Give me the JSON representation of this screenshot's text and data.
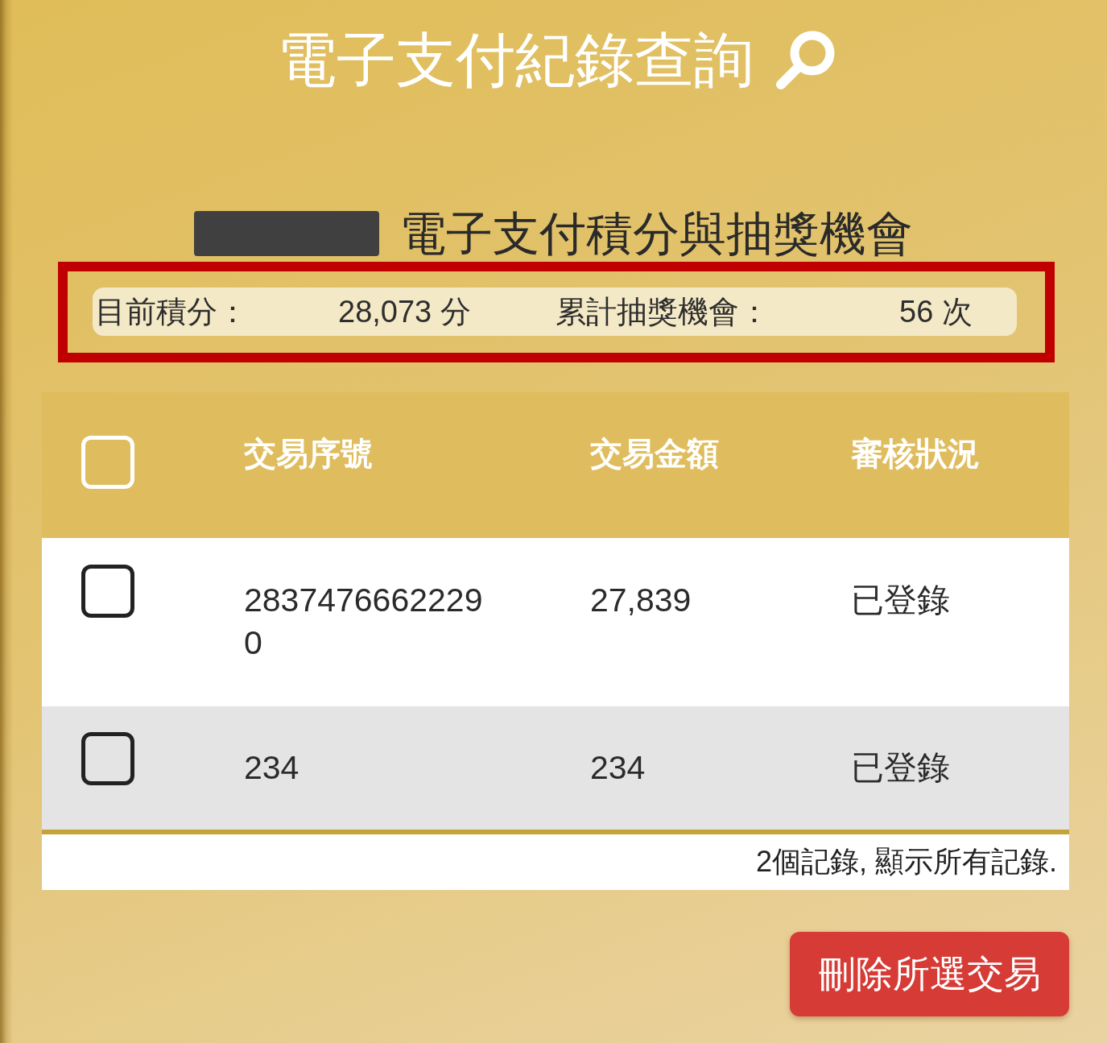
{
  "header": {
    "title": "電子支付紀錄查詢"
  },
  "summary": {
    "subtitle": "電子支付積分與抽獎機會",
    "highlighted": true,
    "stats": [
      {
        "label": "目前積分：",
        "value": "28,073 分"
      },
      {
        "label": "累計抽獎機會：",
        "value": "56 次"
      }
    ]
  },
  "table": {
    "select_all": {
      "checked": false
    },
    "columns": [
      "交易序號",
      "交易金額",
      "審核狀況"
    ],
    "rows": [
      {
        "checked": false,
        "cells": [
          "28374766622290",
          "27,839",
          "已登錄"
        ]
      },
      {
        "checked": false,
        "cells": [
          "234",
          "234",
          "已登錄"
        ]
      }
    ],
    "footer": "2個記錄, 顯示所有記錄."
  },
  "actions": [
    {
      "label": "刪除所選交易"
    }
  ]
}
